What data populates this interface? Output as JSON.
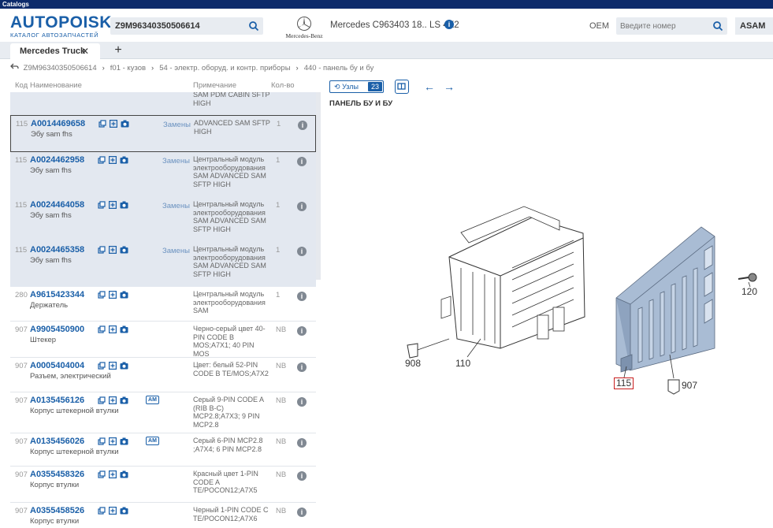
{
  "app": {
    "window_title": "Catalogs"
  },
  "header": {
    "logo_main": "AUTOPOISK",
    "logo_sub": "КАТАЛОГ АВТОЗАПЧАСТЕЙ",
    "vin_value": "Z9M96340350506614",
    "brand_logo_text": "Mercedes-Benz",
    "model_title": "Mercedes C963403 18.. LS 4X2",
    "oem_label": "OEM",
    "oem_placeholder": "Введите номер",
    "asam_label": "ASAM"
  },
  "tabs": [
    {
      "label": "Mercedes Truck"
    }
  ],
  "tab_add": "+",
  "breadcrumb": [
    "Z9M96340350506614",
    "f01 - кузов",
    "54 - электр. оборуд. и контр. приборы",
    "440 - панель бу и бу"
  ],
  "list": {
    "columns": {
      "code": "Код",
      "name": "Наименование",
      "note": "Примечание",
      "qty": "Кол-во"
    },
    "top_partial_note": "SAM PDM CABIN SFTP HIGH",
    "rows": [
      {
        "code": "115",
        "part_number": "A0014469658",
        "name": "Эбу sam fhs",
        "replacement": "Замены",
        "note": "ADVANCED SAM SFTP HIGH",
        "qty": "1",
        "am": ""
      },
      {
        "code": "115",
        "part_number": "A0024462958",
        "name": "Эбу sam fhs",
        "replacement": "Замены",
        "note": "Центральный модуль электрооборудования SAM ADVANCED SAM SFTP HIGH",
        "qty": "1",
        "am": ""
      },
      {
        "code": "115",
        "part_number": "A0024464058",
        "name": "Эбу sam fhs",
        "replacement": "Замены",
        "note": "Центральный модуль электрооборудования SAM ADVANCED SAM SFTP HIGH",
        "qty": "1",
        "am": ""
      },
      {
        "code": "115",
        "part_number": "A0024465358",
        "name": "Эбу sam fhs",
        "replacement": "Замены",
        "note": "Центральный модуль электрооборудования SAM ADVANCED SAM SFTP HIGH",
        "qty": "1",
        "am": ""
      },
      {
        "code": "280",
        "part_number": "A9615423344",
        "name": "Держатель",
        "replacement": "",
        "note": "Центральный модуль электрооборудования SAM",
        "qty": "1",
        "am": ""
      },
      {
        "code": "907",
        "part_number": "A9905450900",
        "name": "Штекер",
        "replacement": "",
        "note": "Черно-серый цвет 40-PIN CODE B MOS;A7X1; 40 PIN MOS",
        "qty": "NB",
        "am": ""
      },
      {
        "code": "907",
        "part_number": "A0005404004",
        "name": "Разъем, электрический",
        "replacement": "",
        "note": "Цвет: белый 52-PIN CODE B TE/MOS;A7X2",
        "qty": "NB",
        "am": ""
      },
      {
        "code": "907",
        "part_number": "A0135456126",
        "name": "Корпус штекерной втулки",
        "replacement": "",
        "note": "Серый 9-PIN CODE A (RIB B-C) MCP2.8;A7X3; 9 PIN MCP2.8",
        "qty": "NB",
        "am": "AM"
      },
      {
        "code": "907",
        "part_number": "A0135456026",
        "name": "Корпус штекерной втулки",
        "replacement": "",
        "note": "Серый 6-PIN MCP2.8 ;A7X4; 6 PIN MCP2.8",
        "qty": "NB",
        "am": "AM"
      },
      {
        "code": "907",
        "part_number": "A0355458326",
        "name": "Корпус втулки",
        "replacement": "",
        "note": "Красный цвет 1-PIN CODE A TE/POCON12;A7X5",
        "qty": "NB",
        "am": ""
      },
      {
        "code": "907",
        "part_number": "A0355458526",
        "name": "Корпус втулки",
        "replacement": "",
        "note": "Черный 1-PIN CODE C TE/POCON12;A7X6",
        "qty": "NB",
        "am": ""
      }
    ]
  },
  "diagram": {
    "nodes_label": "Узлы",
    "nodes_count": "23",
    "title": "ПАНЕЛЬ БУ И БУ",
    "callouts": [
      "908",
      "110",
      "115",
      "907",
      "120"
    ]
  },
  "colors": {
    "brand": "#1a5fa8",
    "titlebar": "#0d2b6b",
    "highlight": "#e3e8f0",
    "callout_box": "#c81e1e"
  }
}
